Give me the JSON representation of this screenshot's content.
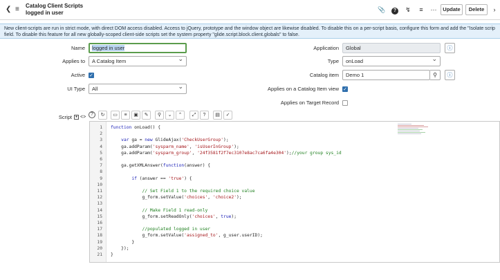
{
  "header": {
    "title": "Catalog Client Scripts",
    "subtitle": "logged in user",
    "update_label": "Update",
    "delete_label": "Delete",
    "icons": [
      "paperclip-icon",
      "help-icon",
      "activity-icon",
      "settings-icon",
      "more-icon"
    ]
  },
  "banner": {
    "line1": "New client-scripts are run in strict mode, with direct DOM access disabled. Access to jQuery, prototype and the window object are likewise disabled. To disable this on a per-script basis, configure this form and add the \"Isolate scrip",
    "line2": "field. To disable this feature for all new globally-scoped client-side scripts set the system property \"glide.script.block.client.globals\" to false."
  },
  "form": {
    "name_label": "Name",
    "name_value": "logged in user",
    "applies_to_label": "Applies to",
    "applies_to_value": "A Catalog Item",
    "active_label": "Active",
    "ui_type_label": "UI Type",
    "ui_type_value": "All",
    "application_label": "Application",
    "application_value": "Global",
    "type_label": "Type",
    "type_value": "onLoad",
    "catalog_item_label": "Catalog item",
    "catalog_item_value": "Demo 1",
    "applies_on_view_label": "Applies on a Catalog Item view",
    "applies_on_target_label": "Applies on Target Record",
    "script_label": "Script"
  },
  "editor": {
    "lines": [
      {
        "n": "1",
        "code": "function onLoad() {"
      },
      {
        "n": "2",
        "code": ""
      },
      {
        "n": "3",
        "code": "    var ga = new GlideAjax('CheckUserGroup');"
      },
      {
        "n": "4",
        "code": "    ga.addParam('sysparm_name', 'isUserInGroup');"
      },
      {
        "n": "5",
        "code": "    ga.addParam('sysparm_group', '24f3581f2f7ec3107e8ac7ca6fa4e304');//your group sys_id"
      },
      {
        "n": "6",
        "code": ""
      },
      {
        "n": "7",
        "code": "    ga.getXMLAnswer(function(answer) {"
      },
      {
        "n": "8",
        "code": ""
      },
      {
        "n": "9",
        "code": "        if (answer == 'true') {"
      },
      {
        "n": "10",
        "code": ""
      },
      {
        "n": "11",
        "code": "            // Set Field 1 to the required choice value"
      },
      {
        "n": "12",
        "code": "            g_form.setValue('choices', 'choice2');"
      },
      {
        "n": "13",
        "code": ""
      },
      {
        "n": "14",
        "code": "            // Make Field 1 read-only"
      },
      {
        "n": "15",
        "code": "            g_form.setReadOnly('choices', true);"
      },
      {
        "n": "16",
        "code": ""
      },
      {
        "n": "17",
        "code": "            //populated logged in user"
      },
      {
        "n": "18",
        "code": "            g_form.setValue('assigned_to', g_user.userID);"
      },
      {
        "n": "19",
        "code": "        }"
      },
      {
        "n": "20",
        "code": "    });"
      },
      {
        "n": "21",
        "code": "}"
      }
    ]
  },
  "colors": {
    "banner_bg": "#e4f0fa",
    "focus_border": "#5a9c4b",
    "checkbox_on": "#2f6fad",
    "keyword": "#1d22b8",
    "string": "#a4161a",
    "comment": "#1e7f1e"
  }
}
